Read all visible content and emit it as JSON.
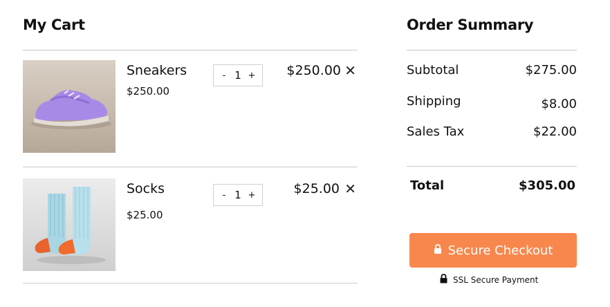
{
  "cart": {
    "title": "My Cart",
    "items": [
      {
        "name": "Sneakers",
        "unit_price": "$250.00",
        "quantity": "1",
        "line_total": "$250.00",
        "decrement": "-",
        "increment": "+",
        "remove": "✕",
        "image": "purple-sneaker-photo"
      },
      {
        "name": "Socks",
        "unit_price": "$25.00",
        "quantity": "1",
        "line_total": "$25.00",
        "decrement": "-",
        "increment": "+",
        "remove": "✕",
        "image": "blue-socks-photo"
      }
    ]
  },
  "summary": {
    "title": "Order Summary",
    "subtotal_label": "Subtotal",
    "subtotal_value": "$275.00",
    "shipping_label": "Shipping",
    "shipping_value": "$8.00",
    "tax_label": "Sales Tax",
    "tax_value": "$22.00",
    "total_label": "Total",
    "total_value": "$305.00",
    "checkout_label": "Secure Checkout",
    "ssl_label": "SSL Secure Payment"
  },
  "colors": {
    "accent": "#f8874d",
    "divider": "#c9c9c9"
  },
  "icons": {
    "checkout": "lock-icon",
    "ssl": "lock-icon",
    "remove": "close-icon"
  }
}
